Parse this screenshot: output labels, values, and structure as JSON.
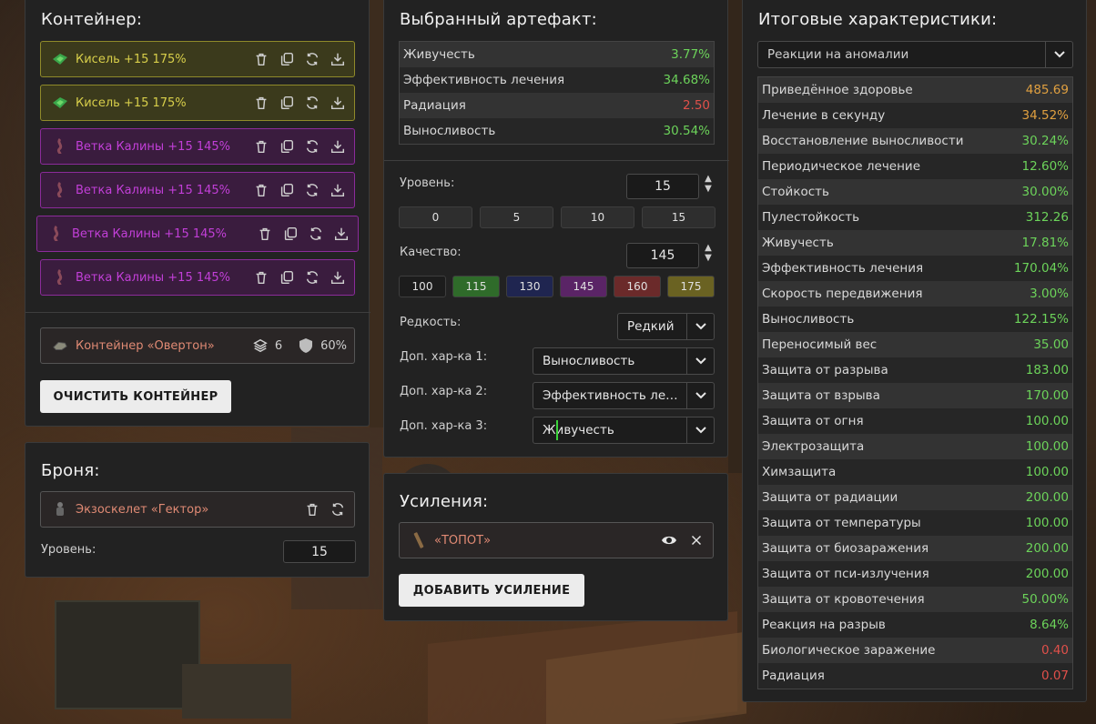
{
  "container": {
    "title": "Контейнер:",
    "artifacts": [
      {
        "name": "Кисель +15 175%",
        "tone": "yellow",
        "icon": "kisel-artifact-icon"
      },
      {
        "name": "Кисель +15 175%",
        "tone": "yellow",
        "icon": "kisel-artifact-icon"
      },
      {
        "name": "Ветка Калины +15 145%",
        "tone": "purple",
        "icon": "kalina-artifact-icon"
      },
      {
        "name": "Ветка Калины +15 145%",
        "tone": "purple",
        "icon": "kalina-artifact-icon"
      },
      {
        "name": "Ветка Калины +15 145%",
        "tone": "purple",
        "icon": "kalina-artifact-icon"
      },
      {
        "name": "Ветка Калины +15 145%",
        "tone": "purple",
        "icon": "kalina-artifact-icon"
      }
    ],
    "container_item": {
      "name": "Контейнер «Овертон»",
      "slots": "6",
      "protection": "60%"
    },
    "clear_button": "ОЧИСТИТЬ КОНТЕЙНЕР"
  },
  "armor": {
    "title": "Броня:",
    "item_name": "Экзоскелет «Гектор»",
    "level_label": "Уровень:",
    "level_value": "15"
  },
  "selected": {
    "title": "Выбранный артефакт:",
    "stats": [
      {
        "name": "Живучесть",
        "value": "3.77%",
        "tone": "green"
      },
      {
        "name": "Эффективность лечения",
        "value": "34.68%",
        "tone": "green"
      },
      {
        "name": "Радиация",
        "value": "2.50",
        "tone": "red"
      },
      {
        "name": "Выносливость",
        "value": "30.54%",
        "tone": "green"
      }
    ],
    "level_label": "Уровень:",
    "level_value": "15",
    "level_presets": [
      "0",
      "5",
      "10",
      "15"
    ],
    "quality_label": "Качество:",
    "quality_value": "145",
    "quality_presets": [
      {
        "label": "100",
        "color": "#1c1c1c"
      },
      {
        "label": "115",
        "color": "#2f6b2a"
      },
      {
        "label": "130",
        "color": "#1f2550"
      },
      {
        "label": "145",
        "color": "#5a2466"
      },
      {
        "label": "160",
        "color": "#6b2a2a"
      },
      {
        "label": "175",
        "color": "#6a6222"
      }
    ],
    "rarity_label": "Редкость:",
    "rarity_value": "Редкий",
    "extra1_label": "Доп. хар-ка 1:",
    "extra1_value": "Выносливость",
    "extra2_label": "Доп. хар-ка 2:",
    "extra2_value": "Эффективность ле…",
    "extra3_label": "Доп. хар-ка 3:",
    "extra3_value": "Живучесть"
  },
  "boosts": {
    "title": "Усиления:",
    "item_name": "«ТОПОТ»",
    "add_button": "ДОБАВИТЬ УСИЛЕНИЕ"
  },
  "totals": {
    "title": "Итоговые характеристики:",
    "filter_value": "Реакции на аномалии",
    "stats": [
      {
        "name": "Приведённое здоровье",
        "value": "485.69",
        "tone": "orange"
      },
      {
        "name": "Лечение в секунду",
        "value": "34.52%",
        "tone": "orange"
      },
      {
        "name": "Восстановление выносливости",
        "value": "30.24%",
        "tone": "green"
      },
      {
        "name": "Периодическое лечение",
        "value": "12.60%",
        "tone": "green"
      },
      {
        "name": "Стойкость",
        "value": "30.00%",
        "tone": "green"
      },
      {
        "name": "Пулестойкость",
        "value": "312.26",
        "tone": "green"
      },
      {
        "name": "Живучесть",
        "value": "17.81%",
        "tone": "green"
      },
      {
        "name": "Эффективность лечения",
        "value": "170.04%",
        "tone": "green"
      },
      {
        "name": "Скорость передвижения",
        "value": "3.00%",
        "tone": "green"
      },
      {
        "name": "Выносливость",
        "value": "122.15%",
        "tone": "green"
      },
      {
        "name": "Переносимый вес",
        "value": "35.00",
        "tone": "green"
      },
      {
        "name": "Защита от разрыва",
        "value": "183.00",
        "tone": "green"
      },
      {
        "name": "Защита от взрыва",
        "value": "170.00",
        "tone": "green"
      },
      {
        "name": "Защита от огня",
        "value": "100.00",
        "tone": "green"
      },
      {
        "name": "Электрозащита",
        "value": "100.00",
        "tone": "green"
      },
      {
        "name": "Химзащита",
        "value": "100.00",
        "tone": "green"
      },
      {
        "name": "Защита от радиации",
        "value": "200.00",
        "tone": "green"
      },
      {
        "name": "Защита от температуры",
        "value": "100.00",
        "tone": "green"
      },
      {
        "name": "Защита от биозаражения",
        "value": "200.00",
        "tone": "green"
      },
      {
        "name": "Защита от пси-излучения",
        "value": "200.00",
        "tone": "green"
      },
      {
        "name": "Защита от кровотечения",
        "value": "50.00%",
        "tone": "green"
      },
      {
        "name": "Реакция на разрыв",
        "value": "8.64%",
        "tone": "green"
      },
      {
        "name": "Биологическое заражение",
        "value": "0.40",
        "tone": "red"
      },
      {
        "name": "Радиация",
        "value": "0.07",
        "tone": "red"
      }
    ]
  }
}
